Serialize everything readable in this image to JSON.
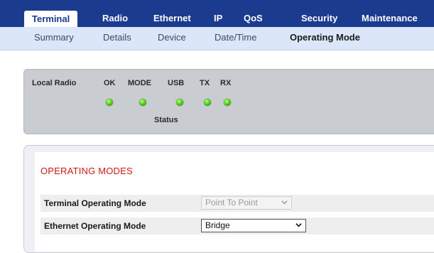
{
  "nav": {
    "tabs": [
      "Terminal",
      "Radio",
      "Ethernet",
      "IP",
      "QoS",
      "Security",
      "Maintenance"
    ],
    "active_tab": "Terminal",
    "subtabs": [
      "Summary",
      "Details",
      "Device",
      "Date/Time",
      "Operating Mode"
    ],
    "active_subtab": "Operating Mode"
  },
  "status": {
    "local_radio_label": "Local Radio",
    "indicators": [
      "OK",
      "MODE",
      "USB",
      "TX",
      "RX"
    ],
    "caption": "Status",
    "led_color": "#55d01f"
  },
  "operating_modes": {
    "title": "OPERATING MODES",
    "rows": [
      {
        "label": "Terminal Operating Mode",
        "value": "Point To Point"
      },
      {
        "label": "Ethernet Operating Mode",
        "value": "Bridge"
      }
    ]
  },
  "colors": {
    "nav_blue": "#1b3b8f",
    "subbar": "#dbe6f8",
    "title_red": "#cc1a1a"
  }
}
